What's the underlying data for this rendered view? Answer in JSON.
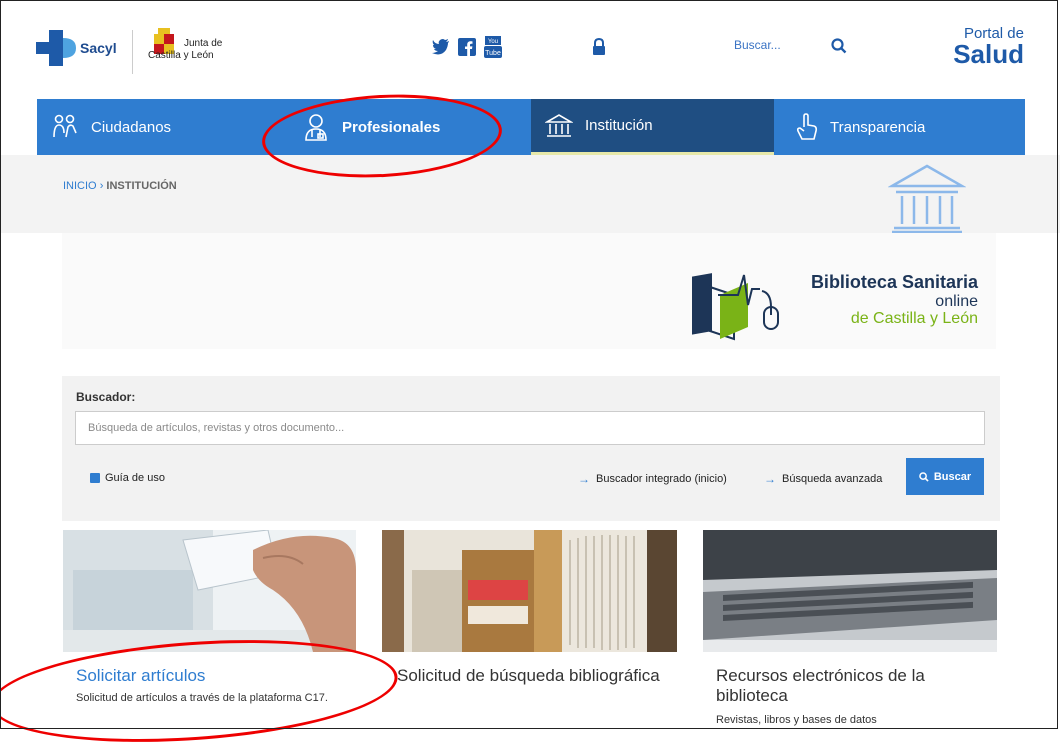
{
  "header": {
    "sacyl": "Sacyl",
    "junta_line1": "Junta de",
    "junta_line2": "Castilla y León",
    "search_label": "Buscar...",
    "portal_line1": "Portal de",
    "portal_line2": "Salud",
    "social": [
      "twitter-icon",
      "facebook-icon",
      "youtube-icon"
    ]
  },
  "nav": {
    "items": [
      {
        "label": "Ciudadanos",
        "icon": "people-icon"
      },
      {
        "label": "Profesionales",
        "icon": "doctor-icon"
      },
      {
        "label": "Institución",
        "icon": "temple-icon"
      },
      {
        "label": "Transparencia",
        "icon": "hand-icon"
      }
    ],
    "active": "Institución"
  },
  "breadcrumb": {
    "home": "INICIO",
    "sep": "›",
    "current": "INSTITUCIÓN"
  },
  "banner": {
    "title_line1": "Biblioteca Sanitaria",
    "title_line2": "online",
    "title_line3": "de Castilla y León"
  },
  "search": {
    "label": "Buscador:",
    "placeholder": "Búsqueda de artículos, revistas y otros documento...",
    "guide": "Guía de uso",
    "link_integrated": "Buscador integrado (inicio)",
    "link_advanced": "Búsqueda avanzada",
    "button": "Buscar"
  },
  "cards": [
    {
      "title": "Solicitar artículos",
      "desc": "Solicitud de artículos a través de la plataforma C17."
    },
    {
      "title": "Solicitud de búsqueda bibliográfica",
      "desc": ""
    },
    {
      "title": "Recursos electrónicos de la biblioteca",
      "desc": "Revistas, libros y bases de datos"
    }
  ],
  "colors": {
    "nav_blue": "#2f7dd0",
    "nav_dark": "#1f4e82",
    "accent_green": "#7ab317",
    "annotation_red": "#e00000"
  }
}
